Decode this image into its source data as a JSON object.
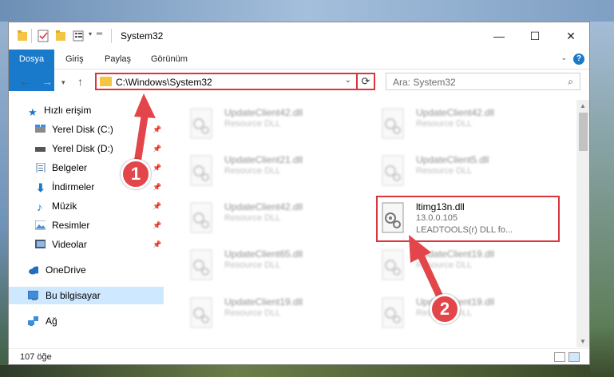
{
  "window": {
    "title": "System32",
    "controls": [
      "—",
      "☐",
      "✕"
    ]
  },
  "ribbon": {
    "tabs": [
      "Dosya",
      "Giriş",
      "Paylaş",
      "Görünüm"
    ],
    "help": "?"
  },
  "nav": {
    "address": "C:\\Windows\\System32",
    "search_placeholder": "Ara: System32"
  },
  "sidebar": {
    "items": [
      {
        "label": "Hızlı erişim",
        "icon": "star-icon"
      },
      {
        "label": "Yerel Disk (C:)",
        "icon": "drive-icon"
      },
      {
        "label": "Yerel Disk (D:)",
        "icon": "drive-icon"
      },
      {
        "label": "Belgeler",
        "icon": "documents-icon"
      },
      {
        "label": "İndirmeler",
        "icon": "download-icon"
      },
      {
        "label": "Müzik",
        "icon": "music-icon"
      },
      {
        "label": "Resimler",
        "icon": "pictures-icon"
      },
      {
        "label": "Videolar",
        "icon": "videos-icon"
      },
      {
        "label": "OneDrive",
        "icon": "cloud-icon"
      },
      {
        "label": "Bu bilgisayar",
        "icon": "computer-icon"
      },
      {
        "label": "Ağ",
        "icon": "network-icon"
      }
    ]
  },
  "files": [
    {
      "name": "UpdateClient42.dll",
      "type": "Resource DLL"
    },
    {
      "name": "UpdateClient42.dll",
      "type": "Resource DLL"
    },
    {
      "name": "UpdateClient21.dll",
      "type": "Resource DLL"
    },
    {
      "name": "UpdateClient5.dll",
      "type": "Resource DLL"
    },
    {
      "name": "UpdateClient42.dll",
      "type": "Resource DLL"
    },
    {
      "name": "ltimg13n.dll",
      "version": "13.0.0.105",
      "type": "LEADTOOLS(r) DLL fo..."
    },
    {
      "name": "UpdateClient65.dll",
      "type": "Resource DLL"
    },
    {
      "name": "UpdateClient19.dll",
      "type": "Resource DLL"
    },
    {
      "name": "UpdateClient19.dll",
      "type": "Resource DLL"
    },
    {
      "name": "UpdateClient19.dll",
      "type": "Resource DLL"
    }
  ],
  "status": {
    "count": "107 öğe"
  },
  "markers": [
    "1",
    "2"
  ],
  "colors": {
    "accent": "#1979ca",
    "highlight": "#d9363e",
    "selected": "#cde8ff"
  }
}
